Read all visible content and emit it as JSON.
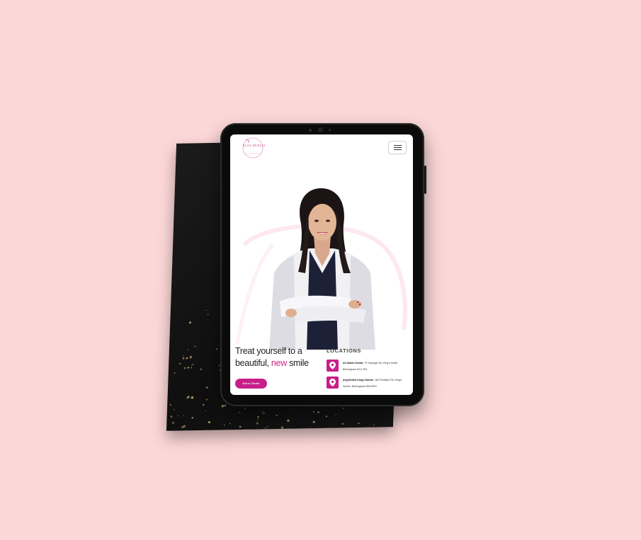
{
  "site": {
    "logo_text": "ELAN DENTAL",
    "menu_icon": "hamburger-icon"
  },
  "hero": {
    "headline_start": "Treat yourself to a beautiful, ",
    "headline_accent": "new",
    "headline_end": " smile",
    "cta_label": "Get in Touch"
  },
  "locations": {
    "title": "LOCATIONS",
    "items": [
      {
        "name": "All Saints Dental",
        "address": ", 70 Vicarage Rd, King's Heath, Birmingham B14 7EA",
        "icon": "map-pin-icon"
      },
      {
        "name": "(my)dentist Kings Norton",
        "address": ", 183 Redditch Rd, Kings Norton, Birmingham B38 8RH",
        "icon": "map-pin-icon"
      }
    ]
  },
  "colors": {
    "background": "#fcd7d7",
    "accent": "#c81e8a",
    "tablet": "#0b0b0b"
  }
}
